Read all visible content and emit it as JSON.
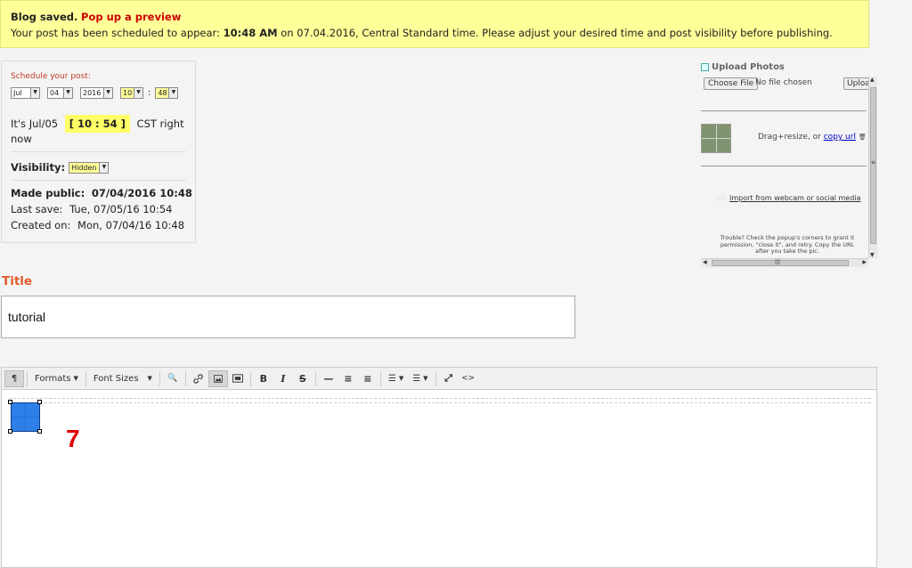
{
  "banner": {
    "saved": "Blog saved.",
    "preview_link": "Pop up a preview",
    "line2_a": "Your post has been scheduled to appear:",
    "line2_time": "10:48 AM",
    "line2_b": "on 07.04.2016, Central Standard time. Please adjust your desired time and post visibility before publishing."
  },
  "schedule": {
    "label": "Schedule your post:",
    "month": "Jul",
    "day": "04",
    "year": "2016",
    "hour": "10",
    "colon": ":",
    "minute": "48",
    "now_prefix": "It's Jul/05",
    "now_clock": "[ 10 : 54 ]",
    "now_suffix": "CST right now",
    "visibility_label": "Visibility:",
    "visibility_value": "Hidden",
    "made_public_label": "Made public:",
    "made_public_value": "07/04/2016 10:48",
    "last_save_label": "Last save:",
    "last_save_value": "Tue, 07/05/16 10:54",
    "created_label": "Created on:",
    "created_value": "Mon, 07/04/16 10:48"
  },
  "upload": {
    "title": "Upload Photos",
    "choose": "Choose File",
    "no_file": "No file chosen",
    "upload_btn": "Upload",
    "drag_text": "Drag+resize, or",
    "copy_url": "copy url",
    "trash": "🗑",
    "import": "Import from webcam or social media",
    "trouble": "Trouble? Check the popup's corners to grant it permission, \"close it\", and retry. Copy the URL after you take the pic.",
    "vscroll_grip": "≡",
    "hscroll_grip": "|||"
  },
  "title_section": {
    "label": "Title",
    "value": "tutorial"
  },
  "toolbar": {
    "paragraph": "¶",
    "formats": "Formats",
    "font_sizes": "Font Sizes",
    "find": "🔍",
    "bold": "B",
    "italic": "I",
    "strike": "S",
    "hr": "—",
    "align_center": "≡",
    "align_right": "≡",
    "bullets": "☰",
    "numbered": "☰",
    "fullscreen": "⤢",
    "code": "<>"
  },
  "editor": {
    "number": "7"
  }
}
